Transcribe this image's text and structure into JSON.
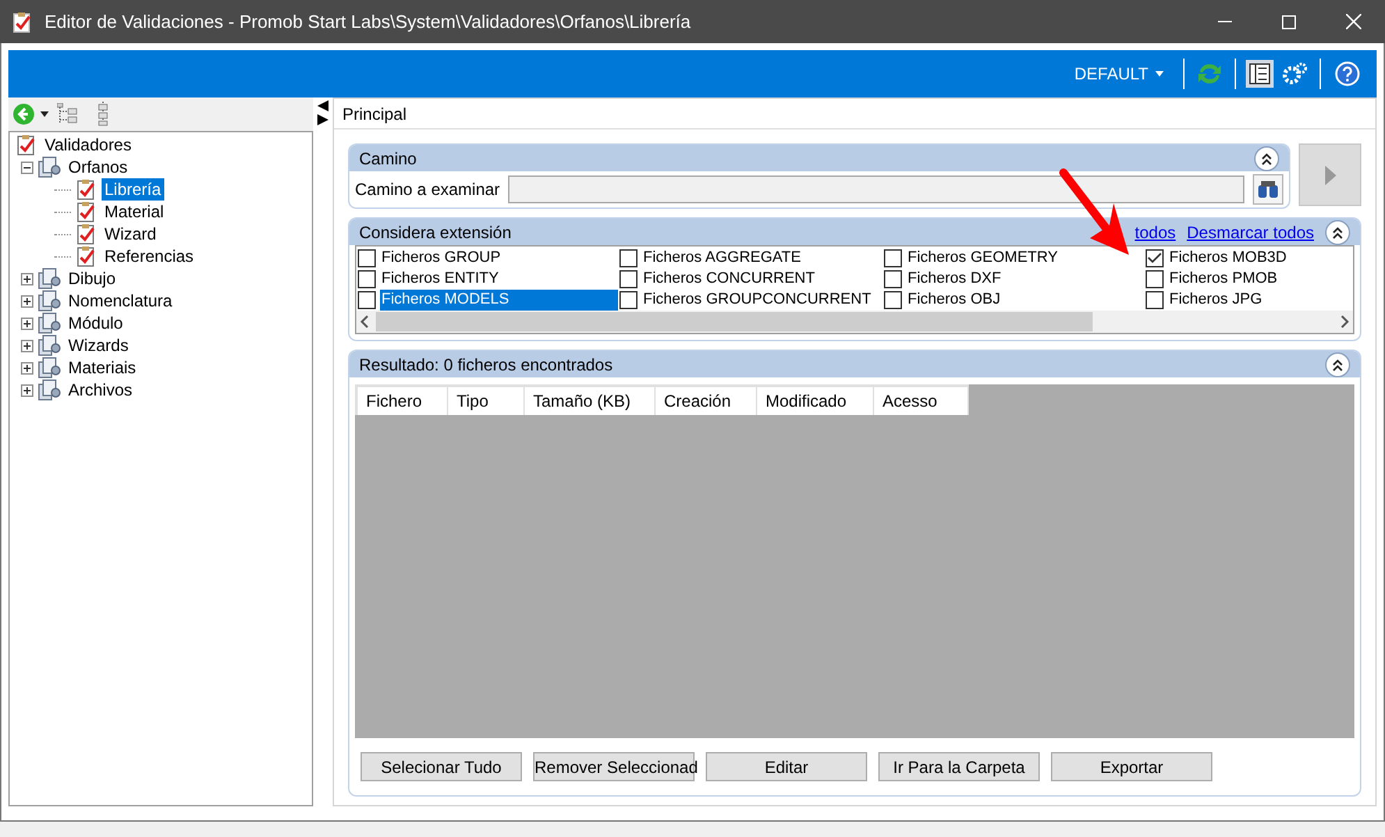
{
  "window": {
    "title": "Editor de Validaciones - Promob Start Labs\\System\\Validadores\\Orfanos\\Librería"
  },
  "toolbar": {
    "profile": "DEFAULT"
  },
  "tree": {
    "items": [
      {
        "label": "Validadores",
        "kind": "root",
        "selected": false,
        "children": [
          {
            "label": "Orfanos",
            "kind": "group",
            "selected": false,
            "expanded": true,
            "children": [
              {
                "label": "Librería",
                "kind": "leaf",
                "selected": true
              },
              {
                "label": "Material",
                "kind": "leaf",
                "selected": false
              },
              {
                "label": "Wizard",
                "kind": "leaf",
                "selected": false
              },
              {
                "label": "Referencias",
                "kind": "leaf",
                "selected": false
              }
            ]
          },
          {
            "label": "Dibujo",
            "kind": "group",
            "selected": false,
            "expanded": false
          },
          {
            "label": "Nomenclatura",
            "kind": "group",
            "selected": false,
            "expanded": false
          },
          {
            "label": "Módulo",
            "kind": "group",
            "selected": false,
            "expanded": false
          },
          {
            "label": "Wizards",
            "kind": "group",
            "selected": false,
            "expanded": false
          },
          {
            "label": "Materiais",
            "kind": "group",
            "selected": false,
            "expanded": false
          },
          {
            "label": "Archivos",
            "kind": "group",
            "selected": false,
            "expanded": false
          }
        ]
      }
    ]
  },
  "tab": {
    "label": "Principal"
  },
  "camino": {
    "title": "Camino",
    "field_label": "Camino a examinar"
  },
  "extensions": {
    "title": "Considera extensión",
    "link_1": "todos",
    "link_2": "Desmarcar todos",
    "columns": [
      [
        {
          "label": "Ficheros GROUP",
          "checked": false,
          "selected": false
        },
        {
          "label": "Ficheros ENTITY",
          "checked": false,
          "selected": false
        },
        {
          "label": "Ficheros MODELS",
          "checked": false,
          "selected": true
        }
      ],
      [
        {
          "label": "Ficheros AGGREGATE",
          "checked": false,
          "selected": false
        },
        {
          "label": "Ficheros CONCURRENT",
          "checked": false,
          "selected": false
        },
        {
          "label": "Ficheros GROUPCONCURRENT",
          "checked": false,
          "selected": false
        }
      ],
      [
        {
          "label": "Ficheros GEOMETRY",
          "checked": false,
          "selected": false
        },
        {
          "label": "Ficheros DXF",
          "checked": false,
          "selected": false
        },
        {
          "label": "Ficheros OBJ",
          "checked": false,
          "selected": false
        }
      ],
      [
        {
          "label": "Ficheros MOB3D",
          "checked": true,
          "selected": false
        },
        {
          "label": "Ficheros PMOB",
          "checked": false,
          "selected": false
        },
        {
          "label": "Ficheros JPG",
          "checked": false,
          "selected": false
        }
      ]
    ]
  },
  "results": {
    "title": "Resultado: 0 ficheros encontrados",
    "columns": [
      "Fichero",
      "Tipo",
      "Tamaño (KB)",
      "Creación",
      "Modificado",
      "Acesso"
    ]
  },
  "buttons": [
    "Selecionar Tudo",
    "Remover Seleccionad",
    "Editar",
    "Ir Para la Carpeta",
    "Exportar"
  ]
}
